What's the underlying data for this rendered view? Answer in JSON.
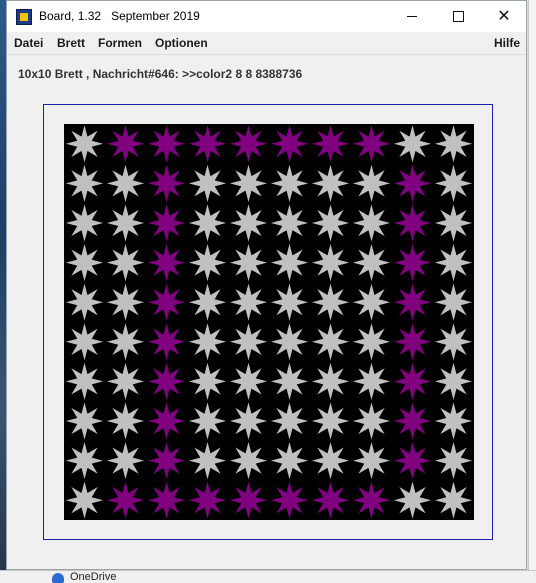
{
  "window": {
    "app_name": "Board, 1.32",
    "date_label": "September 2019",
    "icons": {
      "app": "board-app-icon",
      "minimize": "minimize-icon",
      "maximize": "maximize-icon",
      "close": "close-icon"
    }
  },
  "menu": {
    "items": [
      "Datei",
      "Brett",
      "Formen",
      "Optionen"
    ],
    "help": "Hilfe"
  },
  "status": {
    "text": "10x10 Brett , Nachricht#646: >>color2 8 8 8388736"
  },
  "taskbar": {
    "partial_label": "OneDrive"
  },
  "board": {
    "rows": 10,
    "cols": 10,
    "shape": "star",
    "background_color": "#000000",
    "colors": {
      "0": "#c0c0c0",
      "1": "#800080"
    },
    "cells": [
      [
        0,
        1,
        1,
        1,
        1,
        1,
        1,
        1,
        0,
        0
      ],
      [
        0,
        0,
        1,
        0,
        0,
        0,
        0,
        0,
        1,
        0
      ],
      [
        0,
        0,
        1,
        0,
        0,
        0,
        0,
        0,
        1,
        0
      ],
      [
        0,
        0,
        1,
        0,
        0,
        0,
        0,
        0,
        1,
        0
      ],
      [
        0,
        0,
        1,
        0,
        0,
        0,
        0,
        0,
        1,
        0
      ],
      [
        0,
        0,
        1,
        0,
        0,
        0,
        0,
        0,
        1,
        0
      ],
      [
        0,
        0,
        1,
        0,
        0,
        0,
        0,
        0,
        1,
        0
      ],
      [
        0,
        0,
        1,
        0,
        0,
        0,
        0,
        0,
        1,
        0
      ],
      [
        0,
        0,
        1,
        0,
        0,
        0,
        0,
        0,
        1,
        0
      ],
      [
        0,
        1,
        1,
        1,
        1,
        1,
        1,
        1,
        0,
        0
      ]
    ]
  }
}
